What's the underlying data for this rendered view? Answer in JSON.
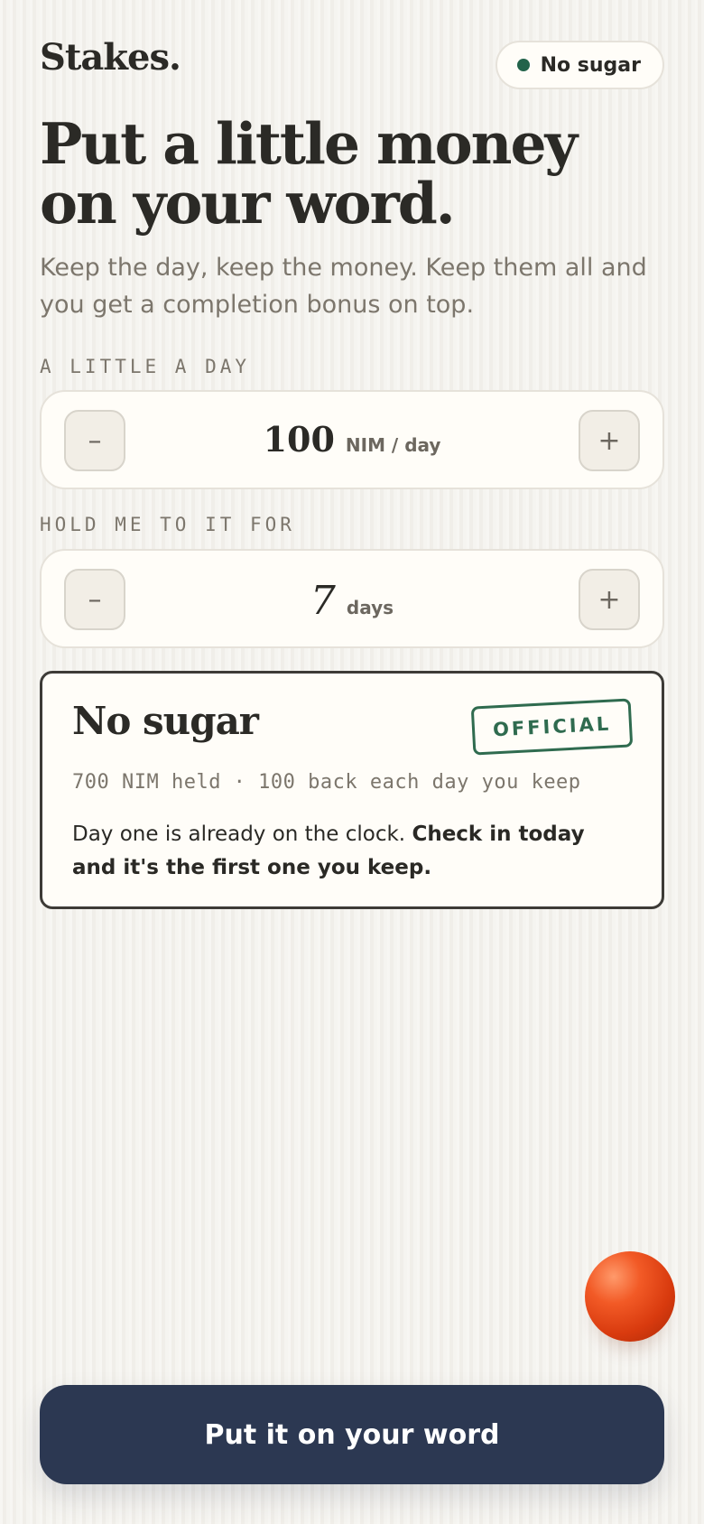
{
  "header": {
    "logo": "Stakes.",
    "status_pill": {
      "label": "No sugar",
      "dot_color": "#22634a"
    }
  },
  "hero": {
    "title_line1": "Put a little money",
    "title_line2": "on your word.",
    "subtitle": "Keep the day, keep the money. Keep them all and you get a completion bonus on top."
  },
  "amount": {
    "label": "A LITTLE A DAY",
    "value": "100",
    "unit": "NIM / day",
    "minus_label": "–",
    "plus_label": "+"
  },
  "duration": {
    "label": "HOLD ME TO IT FOR",
    "value": "7",
    "unit": "days",
    "minus_label": "–",
    "plus_label": "+"
  },
  "summary_card": {
    "title": "No sugar",
    "stamp": "OFFICIAL",
    "meta": "700 NIM held · 100 back each day you keep",
    "body_regular": "Day one is already on the clock. ",
    "body_bold": "Check in today and it's the first one you keep."
  },
  "cta": {
    "label": "Put it on your word"
  },
  "colors": {
    "background": "#f3f1ec",
    "accent_green": "#2f6b4f",
    "cta_navy": "#2c3852",
    "orb": "#e2461a"
  }
}
